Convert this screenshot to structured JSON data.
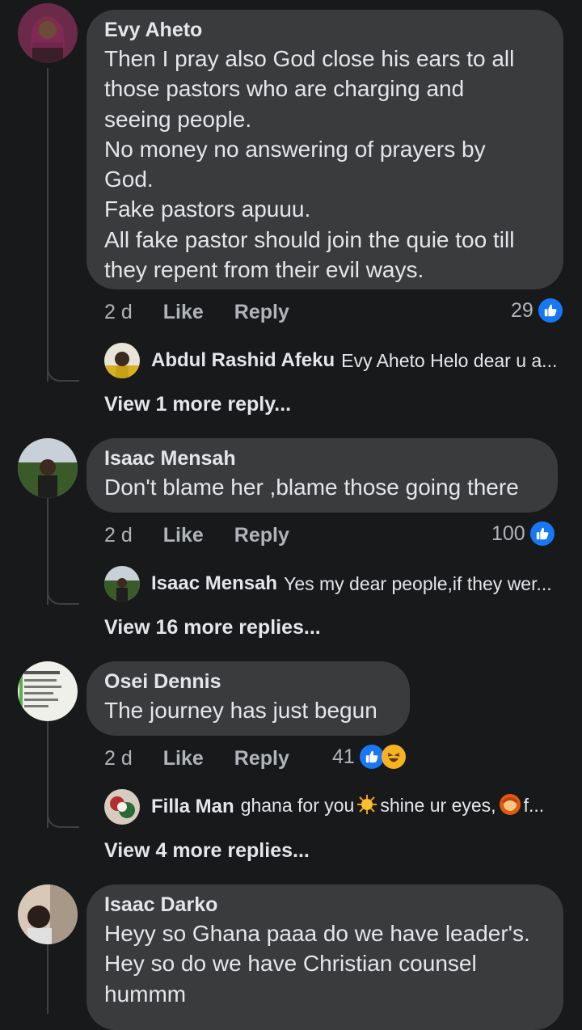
{
  "comments": [
    {
      "author": "Evy Aheto",
      "text": "Then I pray also God close his ears to all\nthose pastors who are charging and\nseeing people.\nNo money no answering of prayers by\nGod.\nFake pastors apuuu.\nAll fake pastor should join the quie too till\nthey repent from their evil ways.",
      "time": "2 d",
      "like_label": "Like",
      "reply_label": "Reply",
      "reactions": "29",
      "reply_preview": {
        "author": "Abdul Rashid Afeku",
        "text": "Evy Aheto Helo dear u a..."
      },
      "view_more": "View 1 more reply..."
    },
    {
      "author": "Isaac Mensah",
      "text": "Don't blame her ,blame those going there",
      "time": "2 d",
      "like_label": "Like",
      "reply_label": "Reply",
      "reactions": "100",
      "reply_preview": {
        "author": "Isaac Mensah",
        "text": "Yes my dear people,if they wer..."
      },
      "view_more": "View 16 more replies..."
    },
    {
      "author": "Osei Dennis",
      "text": "The journey has just begun",
      "time": "2 d",
      "like_label": "Like",
      "reply_label": "Reply",
      "reactions": "41",
      "reply_preview": {
        "author": "Filla Man",
        "text_a": "ghana for you",
        "text_b": "shine ur eyes,",
        "text_c": "f..."
      },
      "view_more": "View 4 more replies..."
    },
    {
      "author": "Isaac Darko",
      "text": "Heyy so Ghana paaa do we have leader's.\nHey so do we have Christian counsel\nhummm"
    }
  ],
  "colors": {
    "background": "#18191a",
    "bubble": "#3a3b3c",
    "like_blue": "#1877f2",
    "muted": "#b0b3b8"
  },
  "icons": [
    "like-reaction-icon",
    "haha-reaction-icon",
    "sun-emoji-icon",
    "woman-emoji-icon"
  ]
}
